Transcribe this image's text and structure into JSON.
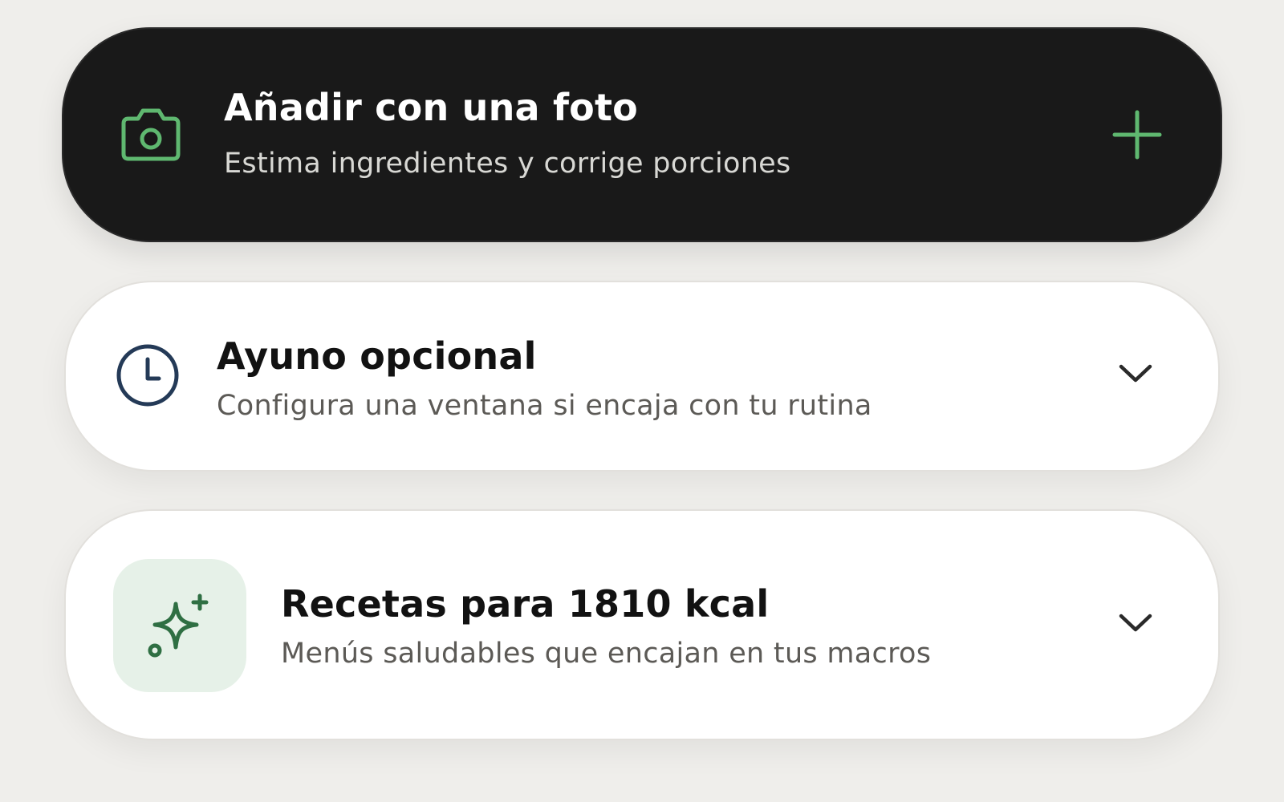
{
  "photo_card": {
    "title": "Añadir con una foto",
    "subtitle": "Estima ingredientes y corrige porciones",
    "icon": "camera-icon",
    "action_icon": "plus-icon",
    "accent_color": "#5fb870",
    "background_color": "#191919"
  },
  "fasting_card": {
    "title": "Ayuno opcional",
    "subtitle": "Configura una ventana si encaja con tu rutina",
    "icon": "clock-icon",
    "action_icon": "chevron-down-icon",
    "icon_color": "#243a57"
  },
  "recipes_card": {
    "title": "Recetas para 1810 kcal",
    "subtitle": "Menús saludables que encajan en tus macros",
    "icon": "sparkles-icon",
    "action_icon": "chevron-down-icon",
    "icon_color": "#2f6f43",
    "icon_background": "#e6f1e8"
  }
}
